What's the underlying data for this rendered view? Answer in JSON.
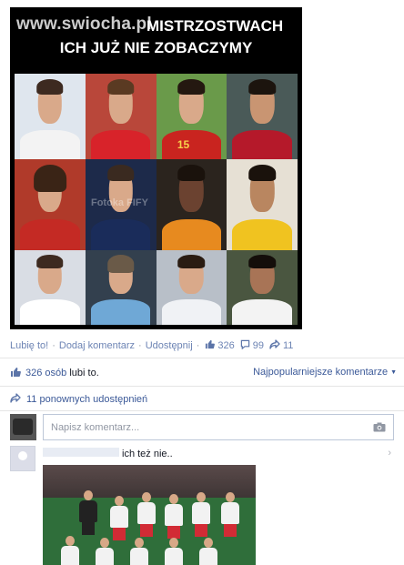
{
  "post": {
    "image": {
      "watermark": "www.swiocha.pl",
      "headline_line1": "MISTRZOSTWACH",
      "headline_line2": "ICH JUŻ NIE ZOBACZYMY",
      "faint_watermark": "Fotoka FIFY"
    }
  },
  "actions": {
    "like": "Lubię to!",
    "comment": "Dodaj komentarz",
    "share": "Udostępnij",
    "like_count": "326",
    "comment_count": "99",
    "share_count": "11"
  },
  "summary": {
    "likes_count": "326",
    "likes_text": "osób",
    "likes_link": "lubi to.",
    "sort_label": "Najpopularniejsze komentarze",
    "shares_text": "11 ponownych udostępnień"
  },
  "composer": {
    "placeholder": "Napisz komentarz..."
  },
  "comments": [
    {
      "text": "ich też nie.."
    }
  ],
  "colors": {
    "link": "#3b5998",
    "muted": "#9197a3",
    "border": "#bdc7d8",
    "poland_red": "#d22b35"
  }
}
